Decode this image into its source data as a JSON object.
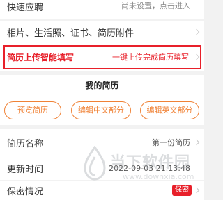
{
  "colors": {
    "accent": "#e8202a",
    "orange": "#f08236",
    "text": "#333333",
    "muted": "#888888"
  },
  "quick_apply": {
    "label": "快速应聘",
    "value": "尚未设置，点击进入"
  },
  "attachments": {
    "label": "相片、生活照、证书、简历附件"
  },
  "smart_fill": {
    "label": "简历上传智能填写",
    "action": "一键上传完成简历填写"
  },
  "my_resume": {
    "title": "我的简历"
  },
  "buttons": {
    "preview": "预览简历",
    "edit_cn": "编辑中文部分",
    "edit_en": "编辑英文部分"
  },
  "resume_name": {
    "label": "简历名称",
    "value": "第一份简历"
  },
  "update_time": {
    "label": "更新时间",
    "value": "2022-09-03 21:13:48"
  },
  "privacy": {
    "label": "保密情况",
    "badge": "保密"
  },
  "watermark": {
    "brand": "当下软件园",
    "url": "www.downxia.com"
  }
}
